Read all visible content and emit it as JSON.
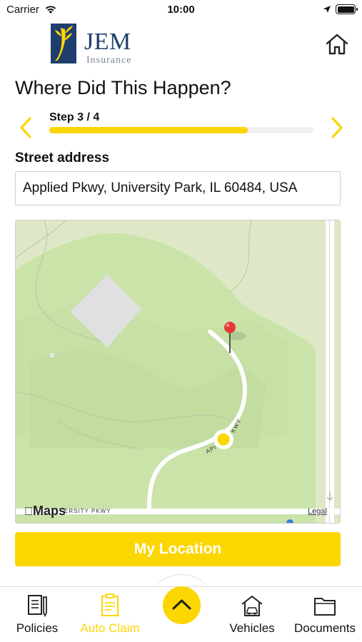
{
  "status_bar": {
    "carrier": "Carrier",
    "time": "10:00"
  },
  "header": {
    "logo_name": "JEM",
    "logo_subtitle": "Insurance",
    "home_icon": "home-icon"
  },
  "page_title": "Where Did This Happen?",
  "stepper": {
    "label": "Step 3 / 4",
    "current_step": 3,
    "total_steps": 4,
    "progress_fraction": 0.75,
    "prev_icon": "chevron-left-icon",
    "next_icon": "chevron-right-icon"
  },
  "address": {
    "label": "Street address",
    "value": "Applied Pkwy, University Park, IL 60484, USA"
  },
  "map": {
    "provider_logo": "Maps",
    "legal": "Legal",
    "road_label_curve": "APPLIED PKWY",
    "road_label_bottom": "UNIVERSITY PKWY",
    "pin_icon": "map-pin-icon",
    "current_location_icon": "current-location-dot"
  },
  "actions": {
    "my_location": "My Location"
  },
  "tab_bar": {
    "center_icon": "chevron-up-icon",
    "items": [
      {
        "label": "Policies",
        "icon": "policies-icon",
        "active": false
      },
      {
        "label": "Auto Claim",
        "icon": "auto-claim-icon",
        "active": true
      },
      {
        "label": "Vehicles",
        "icon": "vehicles-icon",
        "active": false
      },
      {
        "label": "Documents",
        "icon": "documents-icon",
        "active": false
      }
    ]
  },
  "colors": {
    "accent": "#fcd600",
    "brand_navy": "#1f3e6e",
    "pin_red": "#e53935",
    "map_green": "#c9e3a9"
  }
}
